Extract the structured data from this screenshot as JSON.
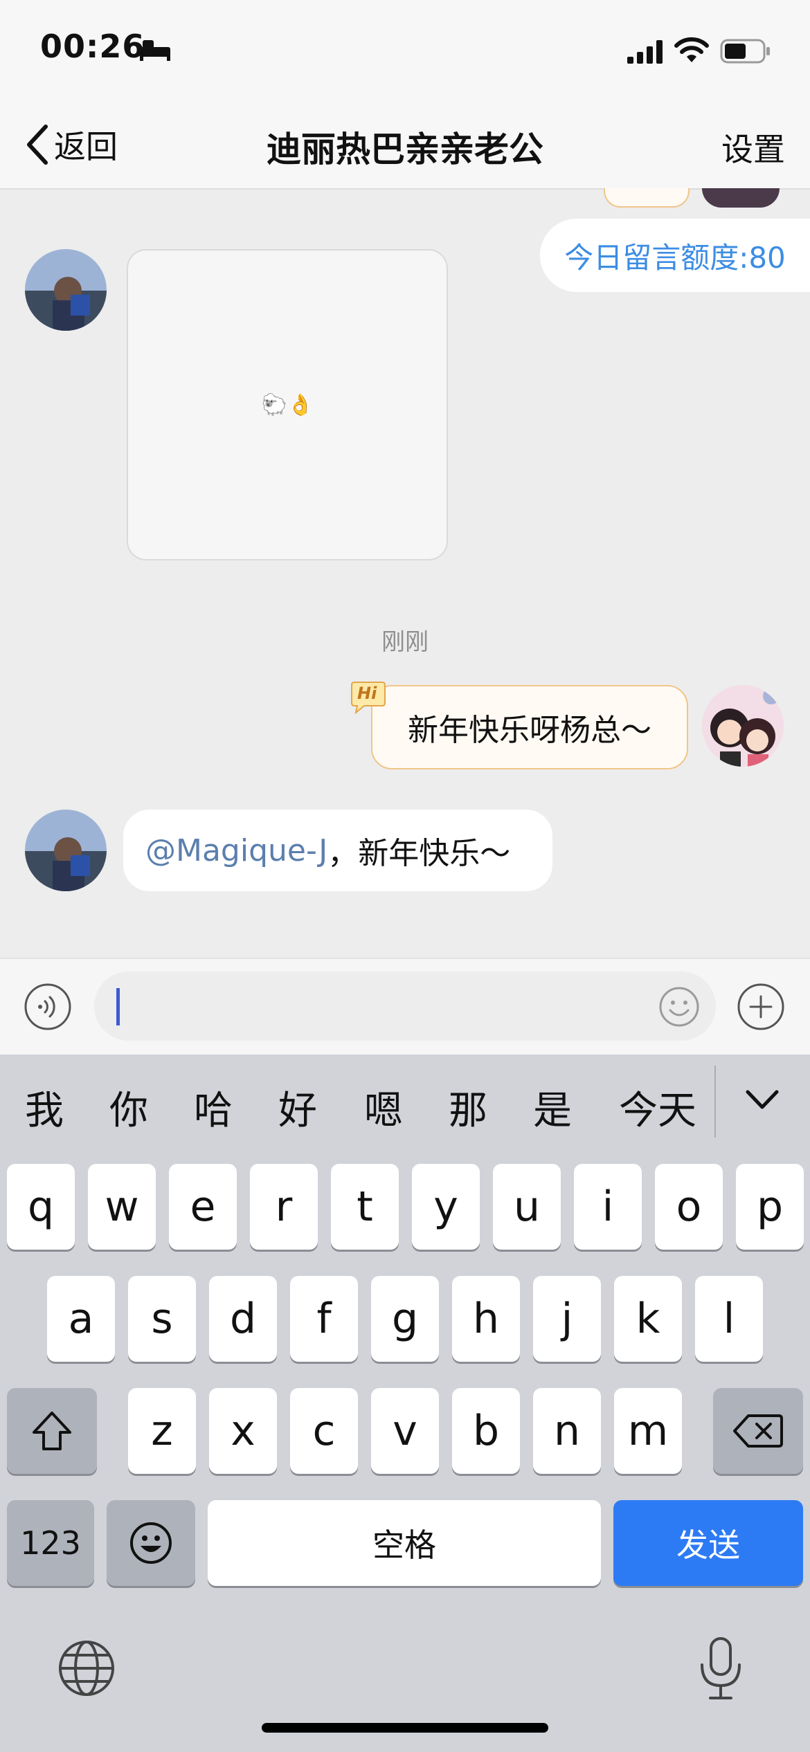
{
  "status": {
    "time": "00:26"
  },
  "nav": {
    "back_label": "返回",
    "title": "迪丽热巴亲亲老公",
    "settings_label": "设置"
  },
  "quota": {
    "text": "今日留言额度:80"
  },
  "messages": {
    "image_caption": "🐑👌",
    "timestamp": "刚刚",
    "me_text": "新年快乐呀杨总～",
    "me_badge": "Hi",
    "other_mention": "@Magique-J",
    "other_text": "，新年快乐～"
  },
  "candidates": [
    "我",
    "你",
    "哈",
    "好",
    "嗯",
    "那",
    "是",
    "今天"
  ],
  "keyboard": {
    "row1": [
      "q",
      "w",
      "e",
      "r",
      "t",
      "y",
      "u",
      "i",
      "o",
      "p"
    ],
    "row2": [
      "a",
      "s",
      "d",
      "f",
      "g",
      "h",
      "j",
      "k",
      "l"
    ],
    "row3": [
      "z",
      "x",
      "c",
      "v",
      "b",
      "n",
      "m"
    ],
    "num_label": "123",
    "space_label": "空格",
    "send_label": "发送"
  },
  "colors": {
    "accent": "#2d7bf4",
    "link": "#3c8de3",
    "mention": "#5b7fae",
    "bubble_border": "#f0c58a"
  },
  "icons": [
    "signal-icon",
    "wifi-icon",
    "battery-icon",
    "bed-icon",
    "back-chevron-icon",
    "voice-icon",
    "emoji-icon",
    "plus-icon",
    "shift-icon",
    "backspace-icon",
    "globe-icon",
    "mic-icon",
    "collapse-chevron-icon"
  ]
}
